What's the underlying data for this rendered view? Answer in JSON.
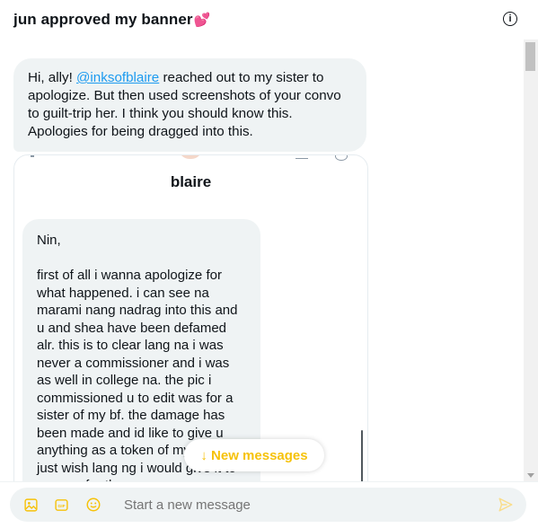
{
  "header": {
    "title": "jun approved my banner",
    "emoji": "💕",
    "info_icon": "info-circle-icon"
  },
  "conversation": {
    "message": {
      "prefix": "Hi, ally! ",
      "mention": "@inksofblaire",
      "suffix": " reached out to my sister to apologize. But then used screenshots of your convo to guilt-trip her. I think you should know this. Apologies for being dragged into this."
    },
    "quoted_card": {
      "name": "blaire",
      "message_text": "Nin,\n\nfirst of all i wanna apologize for what happened. i can see na marami nang nadrag into this and u and shea have been defamed alr. this is to clear lang na i was never a commissioner and i was as well in college na. the pic i commissioned u to edit was for a sister of my bf. the damage has been made and id like to give u anything as a token of my apology, just wish lang ng i would give it to u. sorry for the"
    },
    "new_messages_label": "↓ New messages"
  },
  "composer": {
    "placeholder": "Start a new message",
    "icons": [
      "image-icon",
      "gif-icon",
      "emoji-icon",
      "send-icon"
    ]
  },
  "colors": {
    "accent": "#1d9bf0",
    "new_messages": "#f6c20a",
    "bubble": "#eff3f4"
  }
}
